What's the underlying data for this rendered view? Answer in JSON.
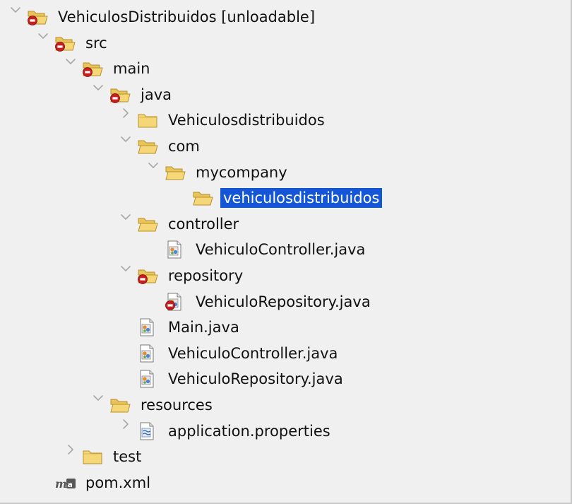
{
  "tree": [
    {
      "label": "VehiculosDistribuidos [unloadable]",
      "icon": "project-folder-error-icon",
      "expander": "expanded",
      "level": 0
    },
    {
      "label": "src",
      "icon": "folder-error-icon",
      "expander": "expanded",
      "level": 1
    },
    {
      "label": "main",
      "icon": "folder-error-icon",
      "expander": "expanded",
      "level": 2
    },
    {
      "label": "java",
      "icon": "folder-error-icon",
      "expander": "expanded",
      "level": 3
    },
    {
      "label": "Vehiculosdistribuidos",
      "icon": "folder-icon",
      "expander": "collapsed",
      "level": 4
    },
    {
      "label": "com",
      "icon": "folder-open-icon",
      "expander": "expanded",
      "level": 4
    },
    {
      "label": "mycompany",
      "icon": "folder-open-icon",
      "expander": "expanded",
      "level": 5
    },
    {
      "label": "vehiculosdistribuidos",
      "icon": "folder-open-icon",
      "expander": "none",
      "level": 6,
      "selected": true
    },
    {
      "label": "controller",
      "icon": "folder-open-icon",
      "expander": "expanded",
      "level": 4
    },
    {
      "label": "VehiculoController.java",
      "icon": "java-file-icon",
      "expander": "none",
      "level": 5
    },
    {
      "label": "repository",
      "icon": "folder-error-icon",
      "expander": "expanded",
      "level": 4
    },
    {
      "label": "VehiculoRepository.java",
      "icon": "java-file-error-icon",
      "expander": "none",
      "level": 5
    },
    {
      "label": "Main.java",
      "icon": "java-file-icon",
      "expander": "none",
      "level": 4
    },
    {
      "label": "VehiculoController.java",
      "icon": "java-file-icon",
      "expander": "none",
      "level": 4
    },
    {
      "label": "VehiculoRepository.java",
      "icon": "java-file-icon",
      "expander": "none",
      "level": 4
    },
    {
      "label": "resources",
      "icon": "folder-open-icon",
      "expander": "expanded",
      "level": 3
    },
    {
      "label": "application.properties",
      "icon": "properties-file-icon",
      "expander": "collapsed",
      "level": 4
    },
    {
      "label": "test",
      "icon": "folder-icon",
      "expander": "collapsed",
      "level": 2
    },
    {
      "label": "pom.xml",
      "icon": "maven-file-icon",
      "expander": "none",
      "level": 1
    }
  ],
  "colors": {
    "background": "#f0f0f0",
    "selection": "#1556d6",
    "folder": "#f6d777",
    "error_badge": "#c81e1e"
  }
}
